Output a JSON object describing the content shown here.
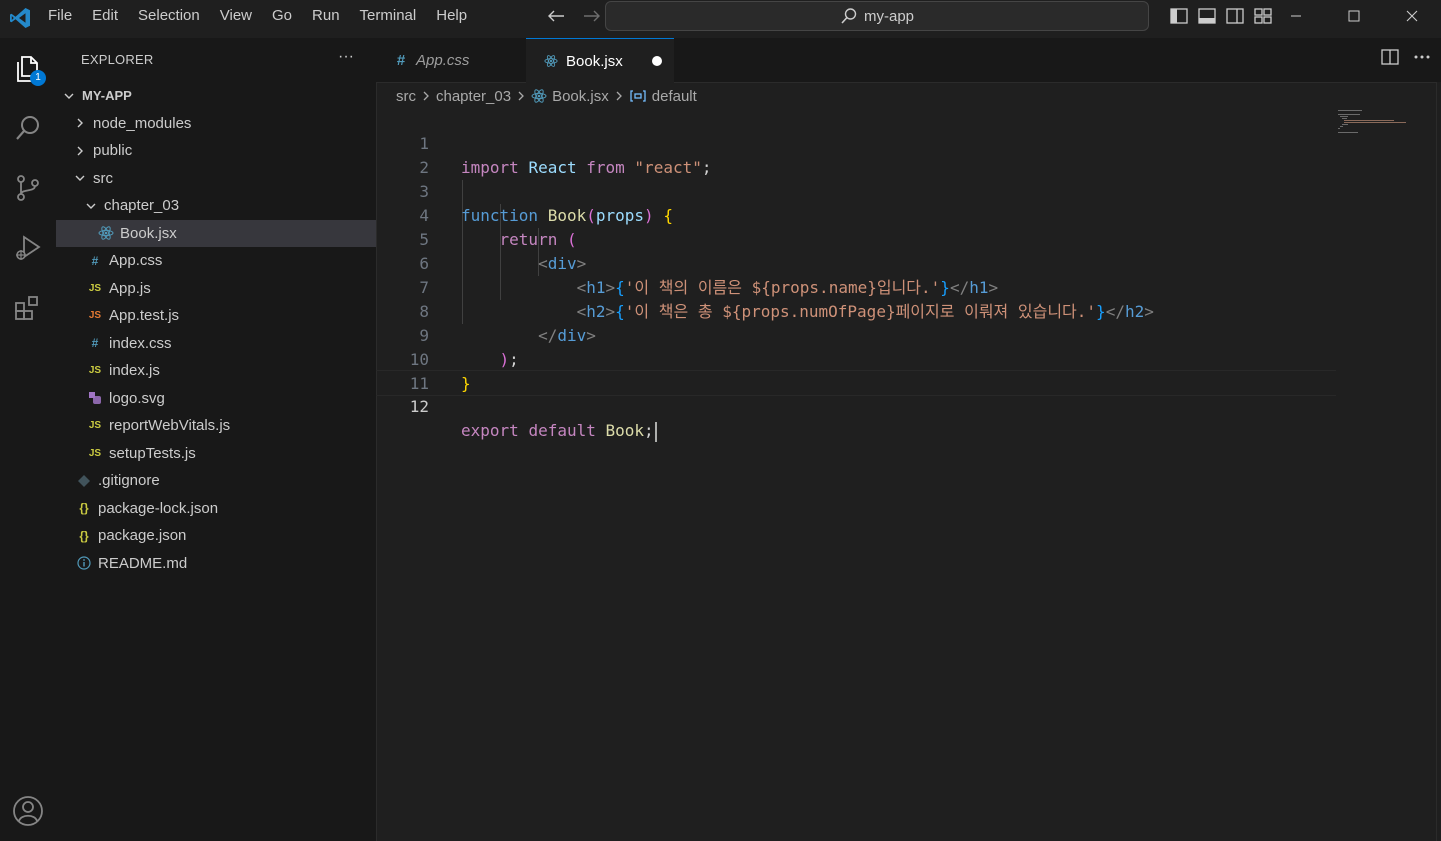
{
  "window": {
    "search_label": "my-app"
  },
  "menu": [
    "File",
    "Edit",
    "Selection",
    "View",
    "Go",
    "Run",
    "Terminal",
    "Help"
  ],
  "activity": {
    "explorer_badge": "1"
  },
  "sidebar": {
    "title": "EXPLORER",
    "more": "···",
    "root": "MY-APP",
    "items": [
      {
        "label": "node_modules",
        "type": "folder",
        "expanded": false,
        "depth": 1
      },
      {
        "label": "public",
        "type": "folder",
        "expanded": false,
        "depth": 1
      },
      {
        "label": "src",
        "type": "folder",
        "expanded": true,
        "depth": 1
      },
      {
        "label": "chapter_03",
        "type": "folder",
        "expanded": true,
        "depth": 2
      },
      {
        "label": "Book.jsx",
        "type": "react",
        "depth": 3,
        "selected": true
      },
      {
        "label": "App.css",
        "type": "css",
        "depth": 2
      },
      {
        "label": "App.js",
        "type": "js",
        "depth": 2
      },
      {
        "label": "App.test.js",
        "type": "test",
        "depth": 2
      },
      {
        "label": "index.css",
        "type": "css",
        "depth": 2
      },
      {
        "label": "index.js",
        "type": "js",
        "depth": 2
      },
      {
        "label": "logo.svg",
        "type": "svg",
        "depth": 2
      },
      {
        "label": "reportWebVitals.js",
        "type": "js",
        "depth": 2
      },
      {
        "label": "setupTests.js",
        "type": "js",
        "depth": 2
      },
      {
        "label": ".gitignore",
        "type": "git",
        "depth": 1
      },
      {
        "label": "package-lock.json",
        "type": "json",
        "depth": 1
      },
      {
        "label": "package.json",
        "type": "json",
        "depth": 1
      },
      {
        "label": "README.md",
        "type": "info",
        "depth": 1
      }
    ]
  },
  "tabs": [
    {
      "label": "App.css",
      "icon": "#"
    },
    {
      "label": "Book.jsx",
      "icon": "react"
    }
  ],
  "breadcrumb": [
    "src",
    "chapter_03",
    "Book.jsx",
    "default"
  ],
  "editor": {
    "line_numbers": [
      "1",
      "2",
      "3",
      "4",
      "5",
      "6",
      "7",
      "8",
      "9",
      "10",
      "11",
      "12"
    ],
    "l1": {
      "import": "import",
      "react": "React",
      "from": "from",
      "str": "\"react\"",
      "semi": ";"
    },
    "l3": {
      "function": "function",
      "name": "Book",
      "open": "(",
      "param": "props",
      "close": ")",
      "brace": "{"
    },
    "l4": {
      "return": "return",
      "paren": "("
    },
    "l5": {
      "lt": "<",
      "tag": "div",
      "gt": ">"
    },
    "l6": {
      "lt": "<",
      "tag": "h1",
      "gt": ">",
      "ob": "{",
      "str": "'이 책의 이름은 ${props.name}입니다.'",
      "cb": "}",
      "clt": "</",
      "ctag": "h1",
      "cgt": ">"
    },
    "l7": {
      "lt": "<",
      "tag": "h2",
      "gt": ">",
      "ob": "{",
      "str": "'이 책은 총 ${props.numOfPage}페이지로 이뤄져 있습니다.'",
      "cb": "}",
      "clt": "</",
      "ctag": "h2",
      "cgt": ">"
    },
    "l8": {
      "clt": "</",
      "tag": "div",
      "gt": ">"
    },
    "l9": {
      "paren": ")",
      "semi": ";"
    },
    "l10": {
      "brace": "}"
    },
    "l12": {
      "export": "export",
      "default": "default",
      "name": "Book",
      "semi": ";"
    }
  },
  "colors": {
    "accent": "#0078d4",
    "editor_bg": "#1f1f1f",
    "sidebar_bg": "#181818",
    "selected_row": "#37373d"
  }
}
